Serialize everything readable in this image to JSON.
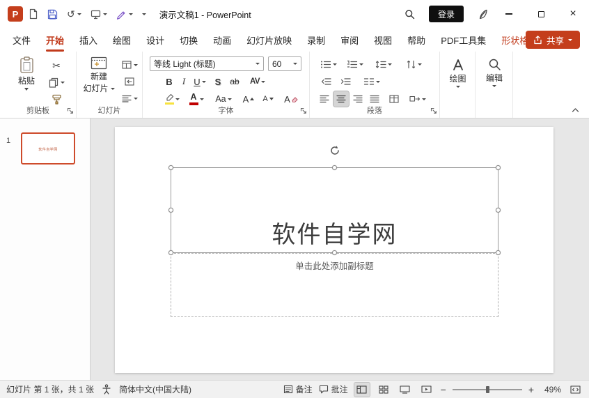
{
  "titlebar": {
    "logo_letter": "P",
    "title": "演示文稿1 - PowerPoint",
    "login": "登录"
  },
  "icons": {
    "undo": "↺",
    "scissors": "✂",
    "close": "×",
    "minus": "−",
    "plus": "+"
  },
  "tabs": {
    "file": "文件",
    "home": "开始",
    "insert": "插入",
    "draw": "绘图",
    "design": "设计",
    "transitions": "切换",
    "animation": "动画",
    "slideshow": "幻灯片放映",
    "record": "录制",
    "review": "审阅",
    "view": "视图",
    "help": "帮助",
    "pdf_tools": "PDF工具集",
    "shape_format": "形状格式",
    "share": "共享"
  },
  "ribbon": {
    "clipboard": {
      "paste": "粘贴",
      "label": "剪贴板"
    },
    "slides": {
      "new_line1": "新建",
      "new_line2": "幻灯片",
      "label": "幻灯片"
    },
    "font": {
      "name": "等线 Light (标题)",
      "size": "60",
      "bold": "B",
      "italic": "I",
      "underline": "U",
      "shadow": "S",
      "strike": "ab",
      "spacing": "AV",
      "case": "Aa",
      "color_letter": "A",
      "grow": "A",
      "shrink": "A",
      "clear": "A",
      "label": "字体"
    },
    "paragraph": {
      "label": "段落"
    },
    "drawing": {
      "label": "绘图"
    },
    "editing": {
      "label": "编辑"
    }
  },
  "thumbnails": {
    "slide_number": "1",
    "slide_title": "软件自学网"
  },
  "slide": {
    "title": "软件自学网",
    "subtitle": "单击此处添加副标题"
  },
  "statusbar": {
    "slide_info": "幻灯片 第 1 张，共 1 张",
    "language": "简体中文(中国大陆)",
    "notes": "备注",
    "comments": "批注",
    "zoom": "49%"
  }
}
